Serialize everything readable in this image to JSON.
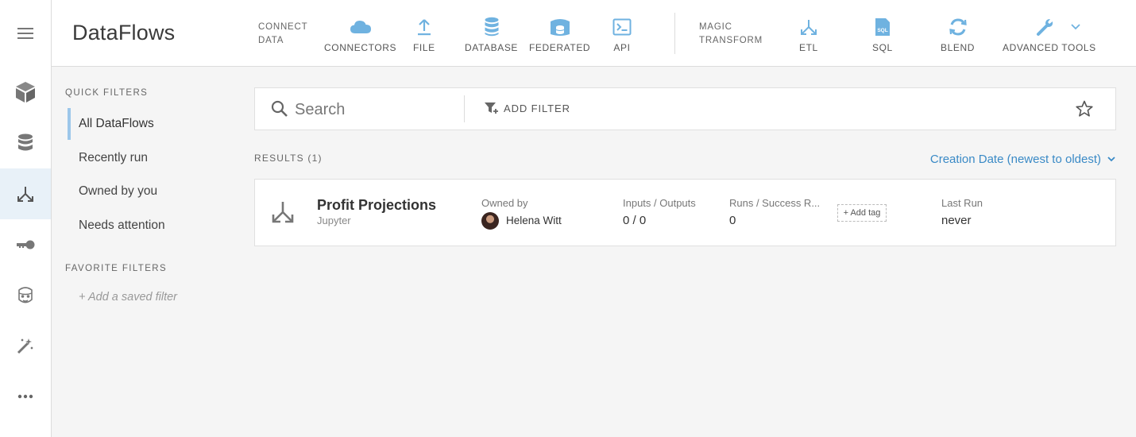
{
  "rail": {
    "items": [
      {
        "name": "menu",
        "icon": "hamburger-menu-icon"
      },
      {
        "name": "cards",
        "icon": "cube-icon"
      },
      {
        "name": "data",
        "icon": "database-icon"
      },
      {
        "name": "dataflows",
        "icon": "dataflow-icon",
        "active": true
      },
      {
        "name": "keys",
        "icon": "key-icon"
      },
      {
        "name": "assistant",
        "icon": "robot-icon"
      },
      {
        "name": "magic",
        "icon": "magic-wand-icon"
      },
      {
        "name": "more",
        "icon": "more-dots-icon"
      }
    ]
  },
  "header": {
    "title": "DataFlows",
    "connect_group": {
      "line1": "CONNECT",
      "line2": "DATA"
    },
    "connect_tools": [
      {
        "label": "CONNECTORS",
        "icon": "cloud-icon"
      },
      {
        "label": "FILE",
        "icon": "upload-icon"
      },
      {
        "label": "DATABASE",
        "icon": "database-icon"
      },
      {
        "label": "FEDERATED",
        "icon": "federated-icon"
      },
      {
        "label": "API",
        "icon": "terminal-icon"
      }
    ],
    "transform_group": {
      "line1": "MAGIC",
      "line2": "TRANSFORM"
    },
    "transform_tools": [
      {
        "label": "ETL",
        "icon": "etl-icon"
      },
      {
        "label": "SQL",
        "icon": "sql-file-icon"
      },
      {
        "label": "BLEND",
        "icon": "blend-icon"
      },
      {
        "label": "ADVANCED TOOLS",
        "icon": "wrench-icon"
      }
    ]
  },
  "quick_filters": {
    "heading": "QUICK FILTERS",
    "items": [
      "All DataFlows",
      "Recently run",
      "Owned by you",
      "Needs attention"
    ],
    "active_index": 0
  },
  "favorite_filters": {
    "heading": "FAVORITE FILTERS",
    "add_label": "+ Add a saved filter"
  },
  "search": {
    "placeholder": "Search",
    "value": "",
    "add_filter_label": "ADD FILTER"
  },
  "results": {
    "label": "RESULTS (1)",
    "sort_label": "Creation Date (newest to oldest)"
  },
  "dataflow": {
    "title": "Profit Projections",
    "type": "Jupyter",
    "owned_by_label": "Owned by",
    "owner": "Helena Witt",
    "io_label": "Inputs / Outputs",
    "io_value": "0 / 0",
    "runs_label": "Runs / Success R...",
    "runs_value": "0",
    "add_tag_label": "+ Add tag",
    "last_run_label": "Last Run",
    "last_run_value": "never"
  },
  "colors": {
    "accent": "#3a8ac6",
    "icon_blue": "#6fb2e0",
    "active_rail": "#e8f1f8",
    "active_filter_bar": "#9cc7ea"
  }
}
